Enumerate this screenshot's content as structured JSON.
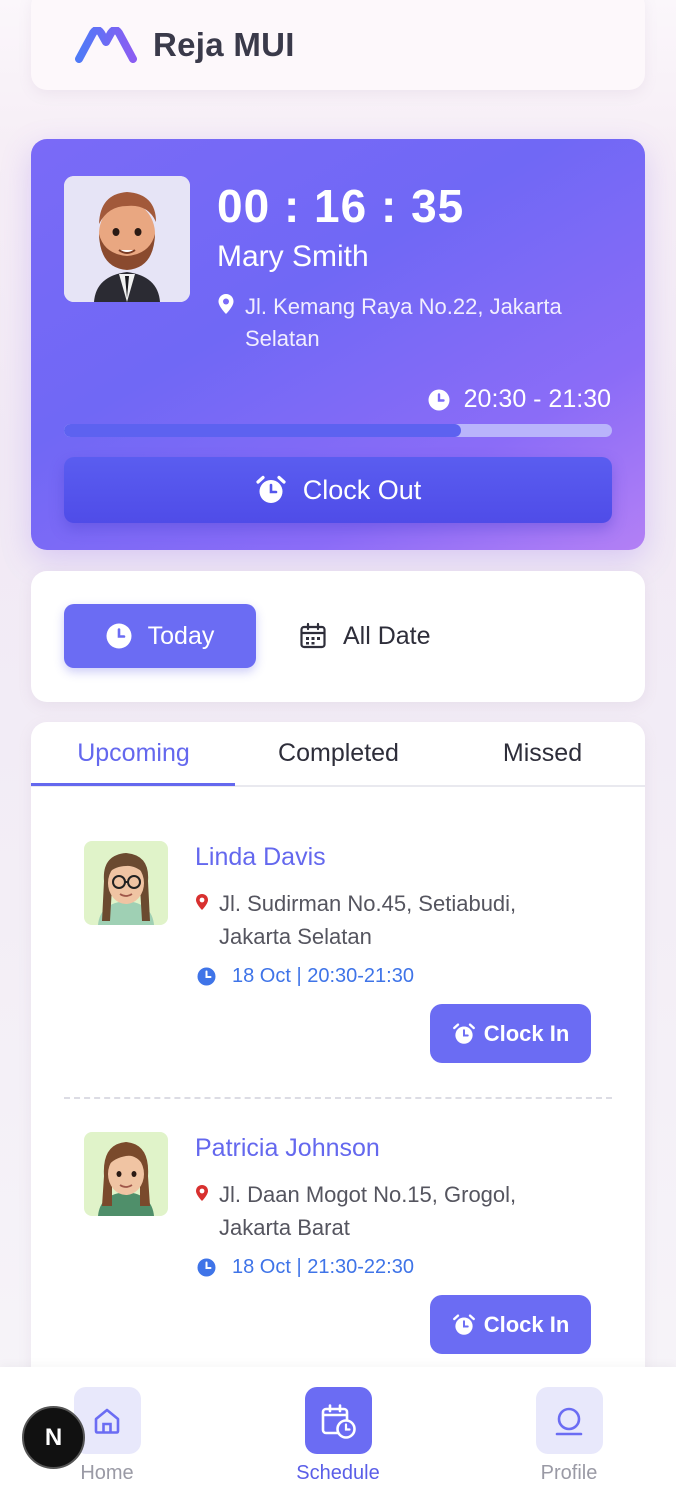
{
  "header": {
    "app_title": "Reja MUI",
    "logo_icon": "reja-logo-icon"
  },
  "active_shift": {
    "timer": "00 : 16 : 35",
    "name": "Mary Smith",
    "location": "Jl. Kemang Raya No.22, Jakarta Selatan",
    "time_range": "20:30 - 21:30",
    "progress": 0.725,
    "clock_out_label": "Clock Out"
  },
  "filter": {
    "today_label": "Today",
    "all_date_label": "All Date"
  },
  "tabs": [
    {
      "label": "Upcoming",
      "active": true
    },
    {
      "label": "Completed",
      "active": false
    },
    {
      "label": "Missed",
      "active": false
    }
  ],
  "schedule": [
    {
      "name": "Linda Davis",
      "location": "Jl. Sudirman No.45, Setiabudi, Jakarta Selatan",
      "time": "18 Oct | 20:30-21:30",
      "button": "Clock In"
    },
    {
      "name": "Patricia Johnson",
      "location": "Jl. Daan Mogot No.15, Grogol, Jakarta Barat",
      "time": "18 Oct | 21:30-22:30",
      "button": "Clock In"
    }
  ],
  "nav": [
    {
      "label": "Home",
      "icon": "home-icon",
      "active": false
    },
    {
      "label": "Schedule",
      "icon": "calendar-clock-icon",
      "active": true
    },
    {
      "label": "Profile",
      "icon": "user-icon",
      "active": false
    }
  ],
  "dev_badge": "N",
  "colors": {
    "primary": "#6b6cf3",
    "accent_text": "#6468ee",
    "time_blue": "#3f74e8",
    "pin_red": "#d8302f"
  }
}
